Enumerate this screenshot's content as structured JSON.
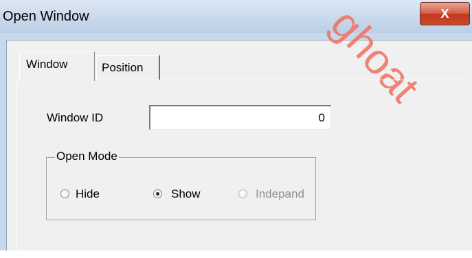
{
  "window": {
    "title": "Open Window",
    "close_glyph": "X"
  },
  "tabs": [
    {
      "label": "Window",
      "active": true
    },
    {
      "label": "Position",
      "active": false
    }
  ],
  "window_id": {
    "label": "Window ID",
    "value": "0"
  },
  "open_mode": {
    "legend": "Open Mode",
    "options": [
      {
        "label": "Hide",
        "checked": false,
        "enabled": true
      },
      {
        "label": "Show",
        "checked": true,
        "enabled": true
      },
      {
        "label": "Indepand",
        "checked": false,
        "enabled": false
      }
    ]
  },
  "watermark": {
    "text": "ghoat"
  },
  "colors": {
    "close_button": "#c8492d",
    "titlebar": "#c9d9ec",
    "watermark": "#f07060"
  }
}
